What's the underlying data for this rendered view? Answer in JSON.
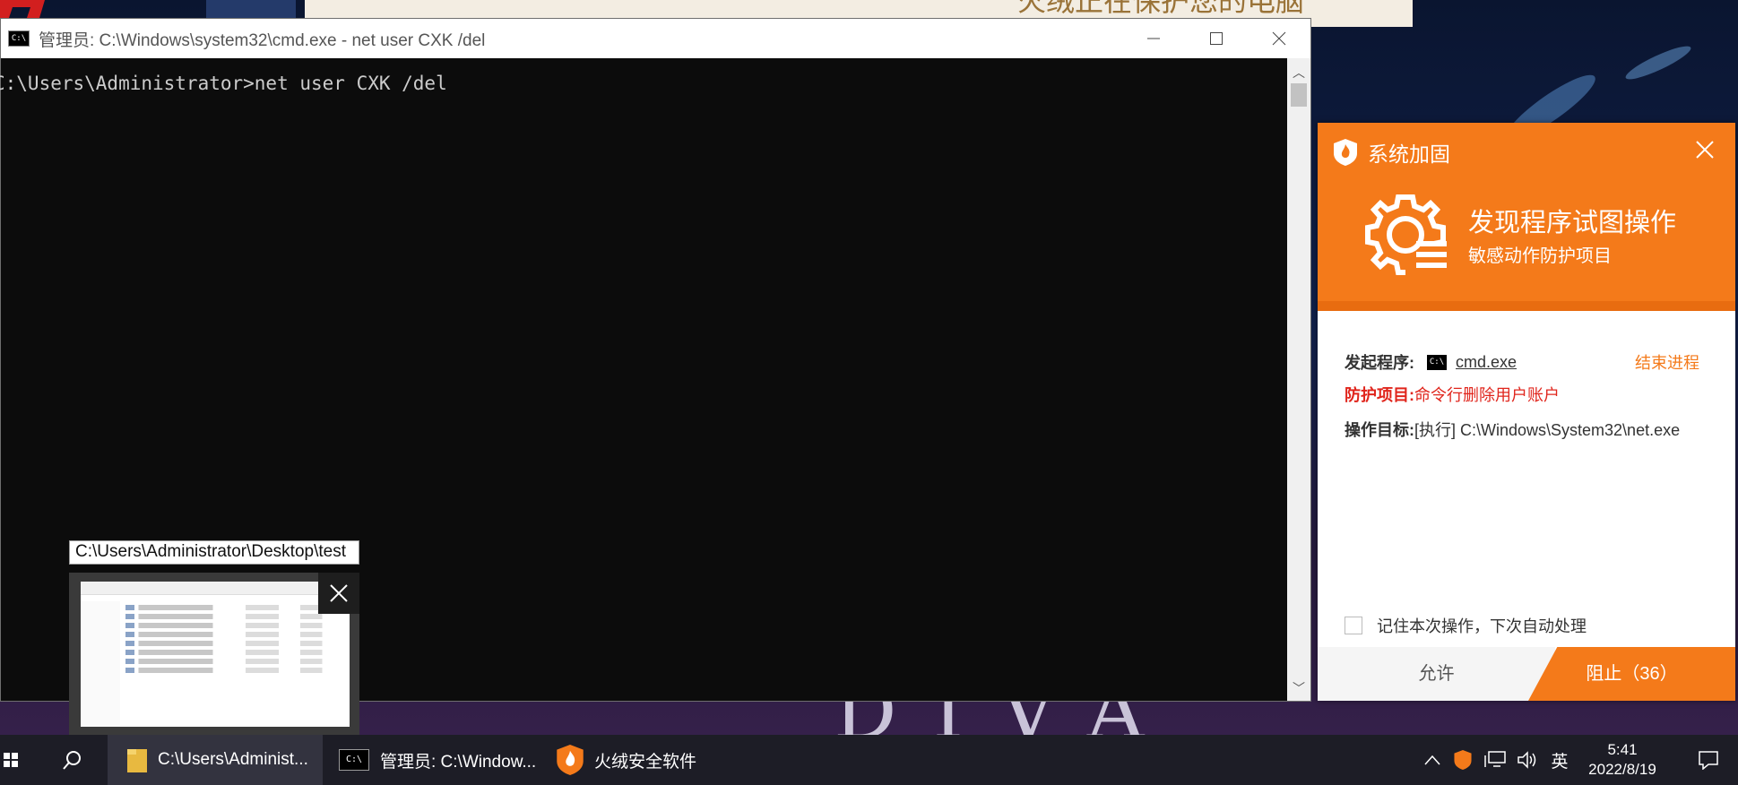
{
  "background": {
    "banner_text": "火绒正在保护您的电脑",
    "wallpaper_text": "DIVA"
  },
  "cmd_window": {
    "title": "管理员: C:\\Windows\\system32\\cmd.exe - net  user CXK /del",
    "icon_text": "C:\\",
    "command_line": "C:\\Users\\Administrator>net user CXK /del"
  },
  "thumbnail": {
    "tooltip": "C:\\Users\\Administrator\\Desktop\\test"
  },
  "alert": {
    "app_name": "系统加固",
    "headline": "发现程序试图操作",
    "subline": "敏感动作防护项目",
    "initiator_label": "发起程序:",
    "initiator_value": "cmd.exe",
    "kill_label": "结束进程",
    "protect_label": "防护项目:",
    "protect_value": "命令行删除用户账户",
    "target_label": "操作目标:",
    "target_value": "[执行] C:\\Windows\\System32\\net.exe",
    "remember_label": "记住本次操作，下次自动处理",
    "allow_label": "允许",
    "block_label": "阻止（36）",
    "accent_color": "#f47a1a",
    "danger_color": "#e0251c"
  },
  "taskbar": {
    "apps": [
      {
        "label": "C:\\Users\\Administ...",
        "icon": "folder-icon"
      },
      {
        "label": "管理员: C:\\Window...",
        "icon": "cmd-icon"
      },
      {
        "label": "火绒安全软件",
        "icon": "huorong-shield-icon"
      }
    ],
    "ime": "英",
    "time": "5:41",
    "date": "2022/8/19"
  }
}
